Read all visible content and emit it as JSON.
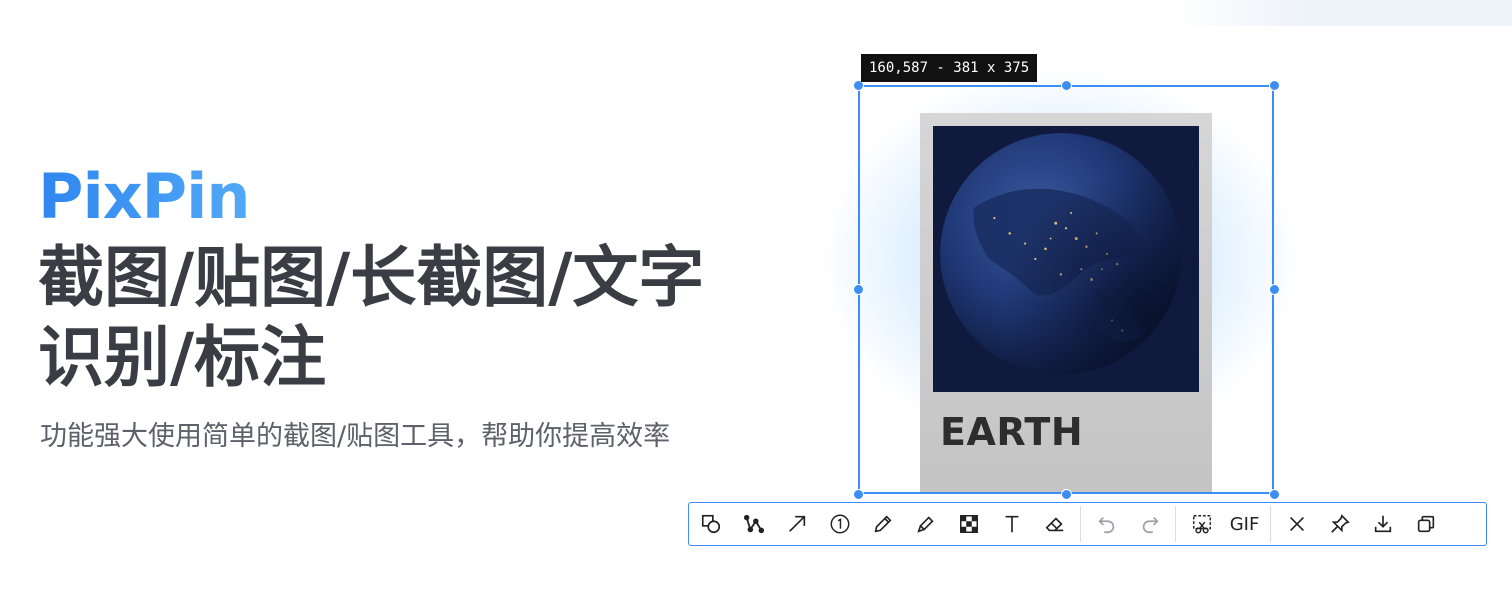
{
  "hero": {
    "brand": "PixPin",
    "headline_line1": "截图/贴图/长截图/文字",
    "headline_line2": "识别/标注",
    "subtitle": "功能强大使用简单的截图/贴图工具，帮助你提高效率"
  },
  "capture": {
    "dimension_label": "160,587 - 381 x 375",
    "card_title": "EARTH",
    "frame_color": "#3b8ef5"
  },
  "toolbar": {
    "groups": [
      {
        "tools": [
          {
            "name": "shape-tool",
            "icon": "shape-icon"
          },
          {
            "name": "polyline-tool",
            "icon": "polyline-icon"
          },
          {
            "name": "arrow-tool",
            "icon": "arrow-icon"
          },
          {
            "name": "number-tool",
            "icon": "number-circle-icon",
            "label": "①"
          },
          {
            "name": "pencil-tool",
            "icon": "pencil-icon"
          },
          {
            "name": "marker-tool",
            "icon": "marker-icon"
          },
          {
            "name": "mosaic-tool",
            "icon": "mosaic-icon"
          },
          {
            "name": "text-tool",
            "icon": "text-icon"
          },
          {
            "name": "eraser-tool",
            "icon": "eraser-icon"
          }
        ]
      },
      {
        "tools": [
          {
            "name": "undo",
            "icon": "undo-icon"
          },
          {
            "name": "redo",
            "icon": "redo-icon"
          }
        ]
      },
      {
        "tools": [
          {
            "name": "long-screenshot",
            "icon": "scroll-capture-icon"
          },
          {
            "name": "gif-record",
            "icon": "gif-icon",
            "label": "GIF"
          }
        ]
      },
      {
        "tools": [
          {
            "name": "close",
            "icon": "close-icon"
          },
          {
            "name": "pin",
            "icon": "pin-icon"
          },
          {
            "name": "save",
            "icon": "download-icon"
          },
          {
            "name": "copy",
            "icon": "copy-icon"
          }
        ]
      }
    ]
  }
}
